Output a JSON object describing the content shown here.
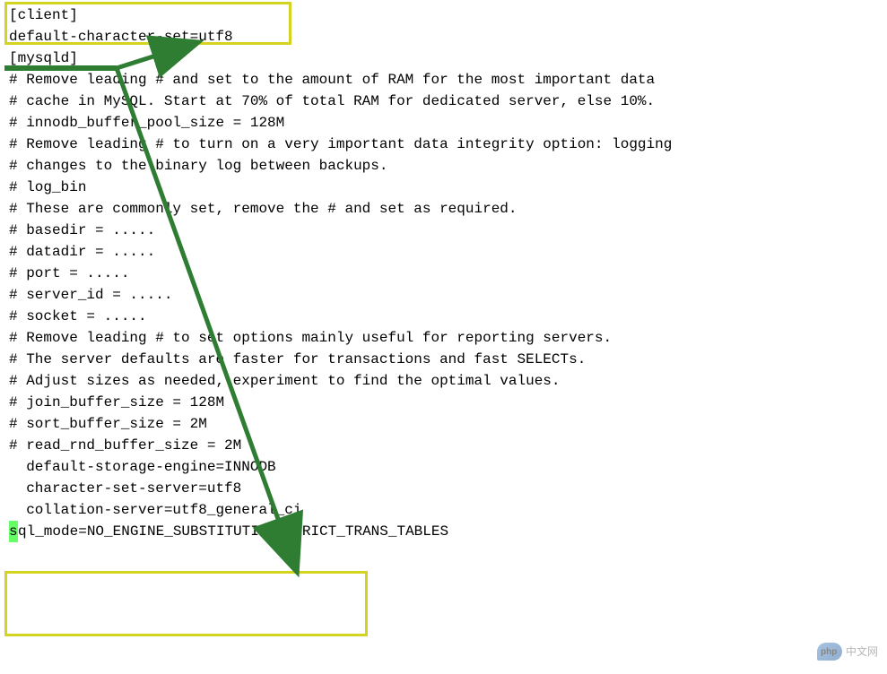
{
  "lines": {
    "l1": "[client]",
    "l2": "default-character-set=utf8",
    "l3": "[mysqld]",
    "l4": "",
    "l5": "# Remove leading # and set to the amount of RAM for the most important data",
    "l6": "# cache in MySQL. Start at 70% of total RAM for dedicated server, else 10%.",
    "l7": "# innodb_buffer_pool_size = 128M",
    "l8": "",
    "l9": "# Remove leading # to turn on a very important data integrity option: logging",
    "l10": "# changes to the binary log between backups.",
    "l11": "# log_bin",
    "l12": "",
    "l13": "# These are commonly set, remove the # and set as required.",
    "l14": "# basedir = .....",
    "l15": "# datadir = .....",
    "l16": "# port = .....",
    "l17": "# server_id = .....",
    "l18": "# socket = .....",
    "l19": "",
    "l20": "# Remove leading # to set options mainly useful for reporting servers.",
    "l21": "# The server defaults are faster for transactions and fast SELECTs.",
    "l22": "# Adjust sizes as needed, experiment to find the optimal values.",
    "l23": "# join_buffer_size = 128M",
    "l24": "# sort_buffer_size = 2M",
    "l25": "# read_rnd_buffer_size = 2M",
    "l26": "  default-storage-engine=INNODB",
    "l27": "  character-set-server=utf8",
    "l28": "  collation-server=utf8_general_ci",
    "l29": "",
    "l30_prefix": "s",
    "l30_rest": "ql_mode=NO_ENGINE_SUBSTITUTION,STRICT_TRANS_TABLES"
  },
  "watermark": "中文网"
}
